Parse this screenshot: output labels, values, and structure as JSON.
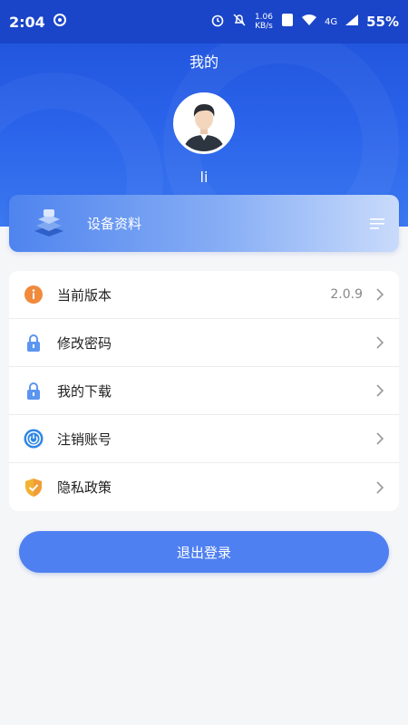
{
  "status_bar": {
    "time": "2:04",
    "net_speed": "1.06 KB/s",
    "network": "4G",
    "battery": "55%"
  },
  "header": {
    "title": "我的",
    "username": "li"
  },
  "device_card": {
    "label": "设备资料"
  },
  "menu": {
    "items": [
      {
        "label": "当前版本",
        "value": "2.0.9",
        "icon": "info-icon",
        "color": "#f08a3c"
      },
      {
        "label": "修改密码",
        "icon": "lock-icon",
        "color": "#5b95f0"
      },
      {
        "label": "我的下载",
        "icon": "lock-icon",
        "color": "#5b95f0"
      },
      {
        "label": "注销账号",
        "icon": "power-icon",
        "color": "#2f86e4"
      },
      {
        "label": "隐私政策",
        "icon": "shield-check-icon",
        "color": "#f2b233"
      }
    ]
  },
  "logout": {
    "label": "退出登录"
  },
  "colors": {
    "accent": "#4f80f1",
    "header": "#2a63ea"
  }
}
